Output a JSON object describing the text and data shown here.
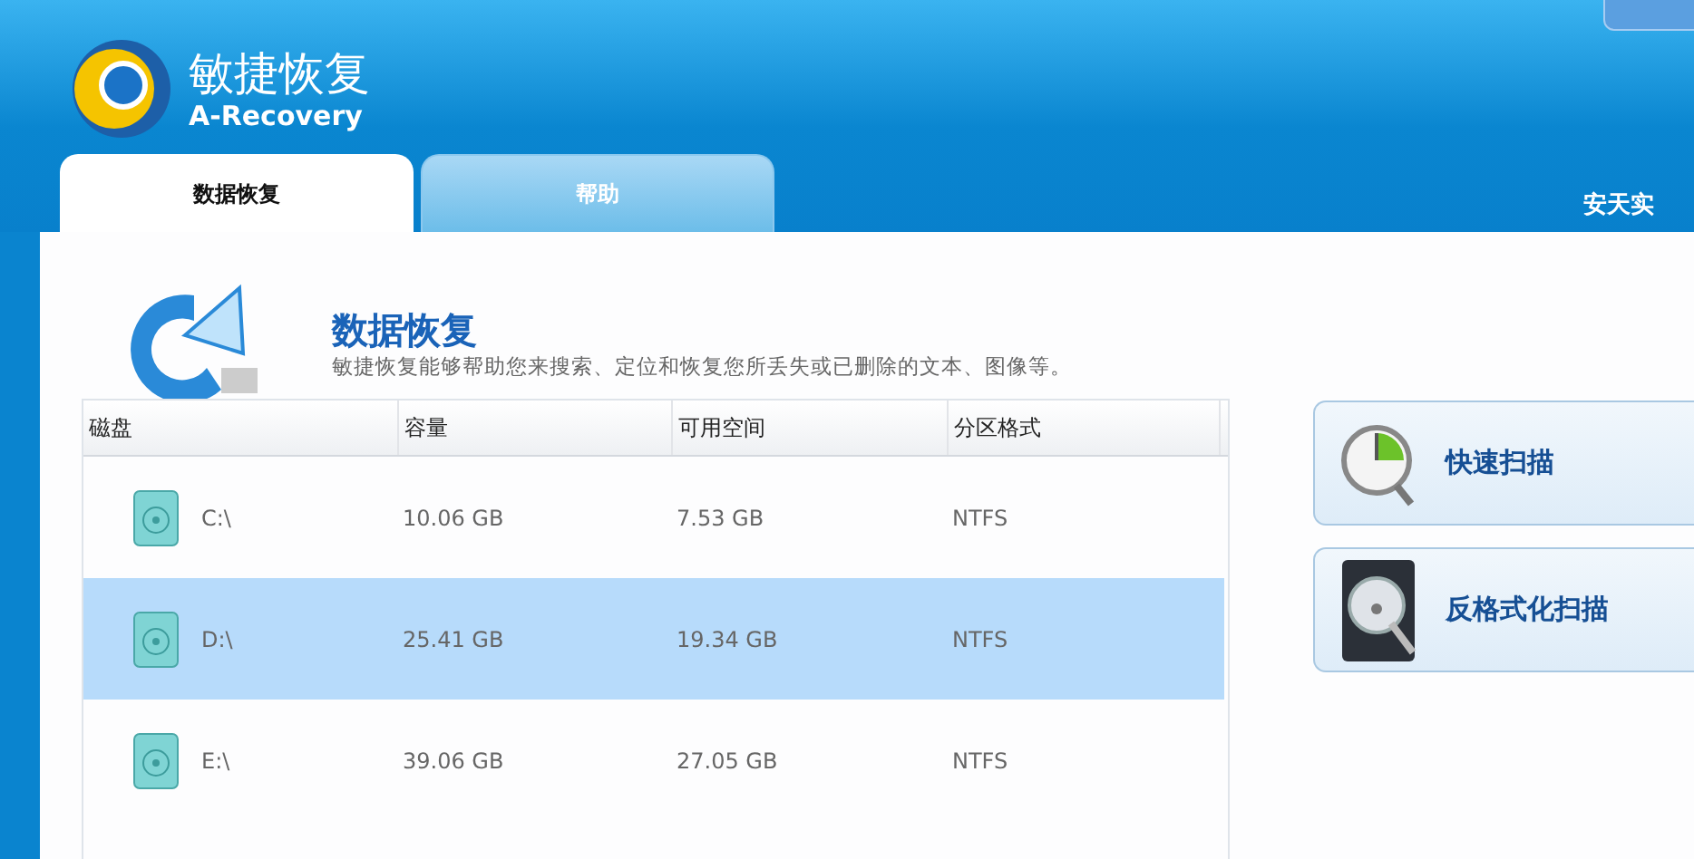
{
  "app": {
    "name": "敏捷恢复",
    "subtitle": "A-Recovery",
    "corner_text": "安天实"
  },
  "tabs": [
    {
      "label": "数据恢复",
      "selected": true
    },
    {
      "label": "帮助",
      "selected": false
    }
  ],
  "section": {
    "title": "数据恢复",
    "description": "敏捷恢复能够帮助您来搜索、定位和恢复您所丢失或已删除的文本、图像等。"
  },
  "table": {
    "columns": [
      "磁盘",
      "容量",
      "可用空间",
      "分区格式"
    ],
    "rows": [
      {
        "drive": "C:\\",
        "capacity": "10.06 GB",
        "free": "7.53 GB",
        "format": "NTFS",
        "selected": false
      },
      {
        "drive": "D:\\",
        "capacity": "25.41 GB",
        "free": "19.34 GB",
        "format": "NTFS",
        "selected": true
      },
      {
        "drive": "E:\\",
        "capacity": "39.06 GB",
        "free": "27.05 GB",
        "format": "NTFS",
        "selected": false
      }
    ]
  },
  "actions": [
    {
      "kind": "quick",
      "label": "快速扫描"
    },
    {
      "kind": "unformat",
      "label": "反格式化扫描"
    }
  ]
}
